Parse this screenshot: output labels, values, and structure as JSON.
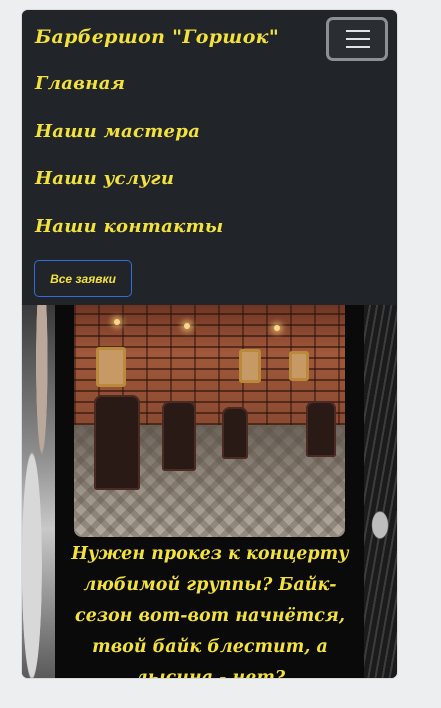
{
  "navbar": {
    "brand": "Барбершоп \"Горшок\"",
    "toggler_icon": "hamburger-icon",
    "links": [
      {
        "label": "Главная"
      },
      {
        "label": "Наши мастера"
      },
      {
        "label": "Наши услуги"
      },
      {
        "label": "Наши контакты"
      }
    ],
    "all_requests_button": "Все заявки"
  },
  "hero": {
    "image_alt": "barbershop-interior-photo",
    "promo_text": "Нужен прокез к концерту любимой группы? Байк-сезон вот-вот начнётся, твой байк блестит, а лысина - нет?"
  },
  "colors": {
    "accent_text": "#f2e23b",
    "navbar_bg": "#212429",
    "button_border": "#2d6fd6",
    "page_bg": "#eceef0"
  }
}
